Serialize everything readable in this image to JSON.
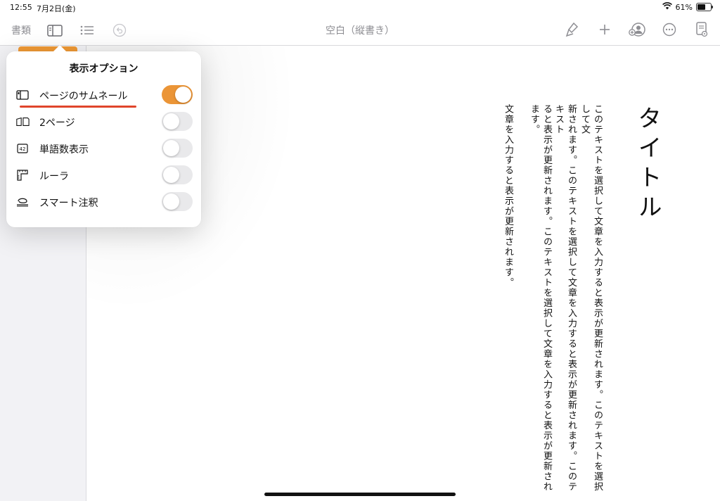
{
  "status": {
    "time": "12:55",
    "date": "7月2日(金)",
    "battery": "61%",
    "battery_level": 0.61
  },
  "toolbar": {
    "docs_label": "書類",
    "title": "空白（縦書き）"
  },
  "popover": {
    "title": "表示オプション",
    "options": [
      {
        "label": "ページのサムネール",
        "icon": "thumbnail-sidebar-icon",
        "on": true
      },
      {
        "label": "2ページ",
        "icon": "two-pages-icon",
        "on": false
      },
      {
        "label": "単語数表示",
        "icon": "word-count-icon",
        "on": false
      },
      {
        "label": "ルーラ",
        "icon": "ruler-icon",
        "on": false
      },
      {
        "label": "スマート注釈",
        "icon": "smart-annotation-icon",
        "on": false
      }
    ]
  },
  "document": {
    "title": "タイトル",
    "columns": [
      "このテキストを選択して文章を入力すると表示が更新されます。このテキストを選択して文",
      "新されます。このテキストを選択して文章を入力すると表示が更新されます。このテキスト",
      "ると表示が更新されます。このテキストを選択して文章を入力すると表示が更新されます。",
      "文章を入力すると表示が更新されます。"
    ]
  },
  "colors": {
    "accent": "#eb9537",
    "highlight": "#e0452b"
  }
}
